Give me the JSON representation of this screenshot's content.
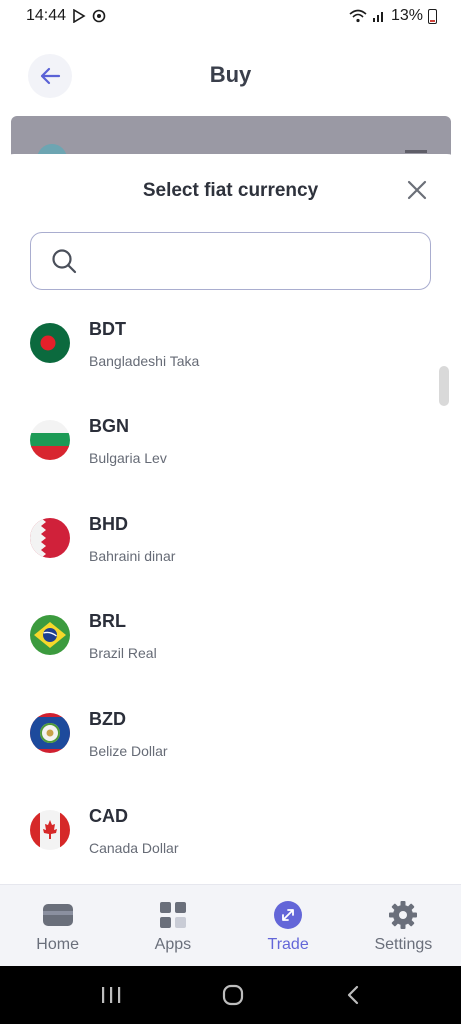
{
  "status_bar": {
    "time": "14:44",
    "battery": "13%"
  },
  "header": {
    "title": "Buy"
  },
  "sheet": {
    "title": "Select fiat currency",
    "search": {
      "value": "",
      "placeholder": ""
    }
  },
  "currencies": [
    {
      "code": "BDT",
      "name": "Bangladeshi Taka",
      "flag": "bangladesh-flag"
    },
    {
      "code": "BGN",
      "name": "Bulgaria Lev",
      "flag": "bulgaria-flag"
    },
    {
      "code": "BHD",
      "name": "Bahraini dinar",
      "flag": "bahrain-flag"
    },
    {
      "code": "BRL",
      "name": "Brazil Real",
      "flag": "brazil-flag"
    },
    {
      "code": "BZD",
      "name": "Belize Dollar",
      "flag": "belize-flag"
    },
    {
      "code": "CAD",
      "name": "Canada Dollar",
      "flag": "canada-flag"
    }
  ],
  "nav": {
    "items": [
      {
        "label": "Home",
        "icon": "wallet-icon",
        "active": false
      },
      {
        "label": "Apps",
        "icon": "apps-grid-icon",
        "active": false
      },
      {
        "label": "Trade",
        "icon": "trade-icon",
        "active": true
      },
      {
        "label": "Settings",
        "icon": "gear-icon",
        "active": false
      }
    ]
  },
  "colors": {
    "accent": "#6366d8",
    "search_border": "#a9adcf",
    "nav_bg": "#f3f4f8"
  }
}
